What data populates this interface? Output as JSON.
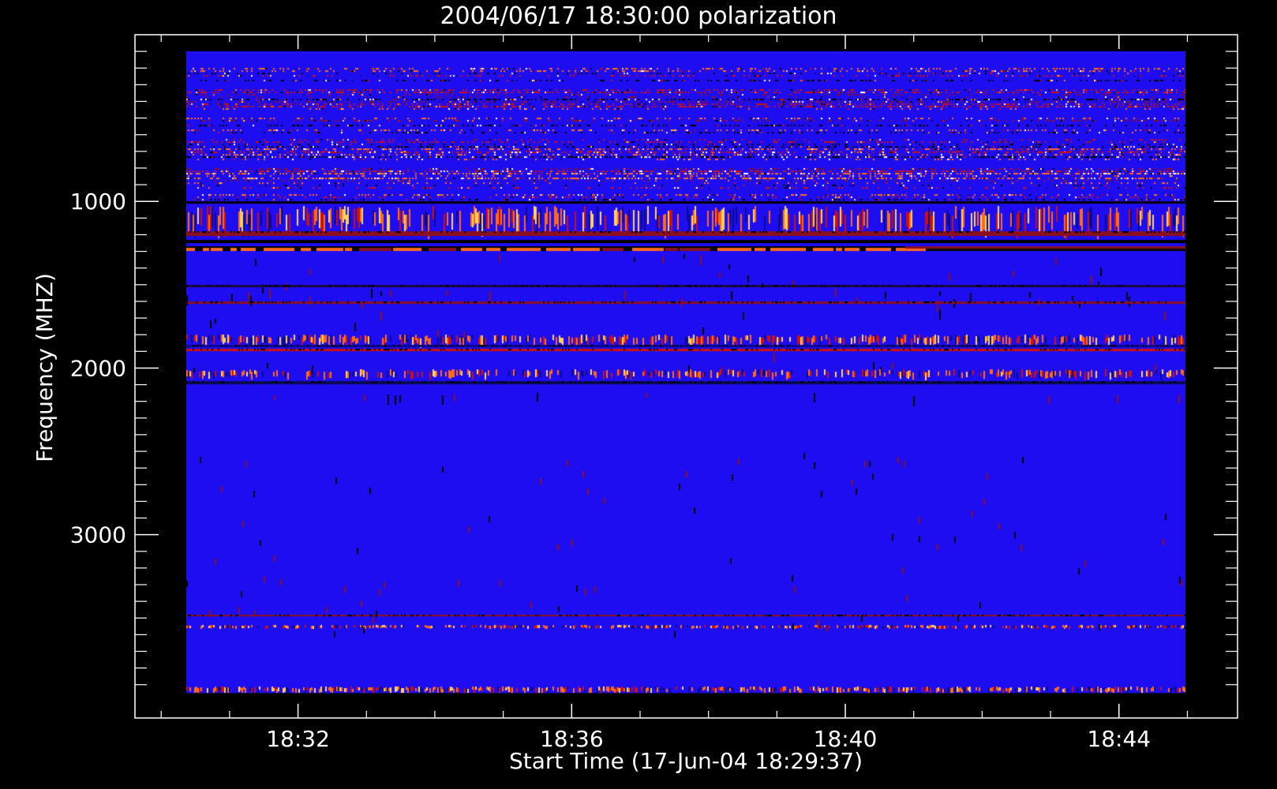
{
  "chart_data": {
    "type": "heatmap",
    "title": "2004/06/17 18:30:00 polarization",
    "xlabel": "Start Time (17-Jun-04 18:29:37)",
    "ylabel": "Frequency (MHZ)",
    "x_ticks": [
      {
        "label": "18:32",
        "minutes_after_1830": 2
      },
      {
        "label": "18:36",
        "minutes_after_1830": 6
      },
      {
        "label": "18:40",
        "minutes_after_1830": 10
      },
      {
        "label": "18:44",
        "minutes_after_1830": 14
      }
    ],
    "y_ticks": [
      {
        "label": "1000",
        "value": 1000
      },
      {
        "label": "2000",
        "value": 2000
      },
      {
        "label": "3000",
        "value": 3000
      }
    ],
    "xlim": [
      "18:29:37",
      "18:45:44"
    ],
    "ylim": [
      4100,
      0
    ],
    "data_time_range": [
      "18:30:00",
      "18:45:00"
    ],
    "data_frequency_range_mhz": [
      100,
      3950
    ],
    "colors": {
      "background": "#000000",
      "axes": "#ffffff",
      "base": "#1f0df2",
      "dark_blue": "#0a0a8c",
      "black": "#000000",
      "red": "#cc1010",
      "dark_red": "#8a1020",
      "orange": "#ff6a1a",
      "yellow": "#ffd060",
      "white": "#ffffff"
    },
    "bands": [
      {
        "f0": 100,
        "f1": 200,
        "kind": "solid",
        "color": "#1f0df2"
      },
      {
        "f0": 200,
        "f1": 700,
        "kind": "dense"
      },
      {
        "f0": 700,
        "f1": 870,
        "kind": "denseBright"
      },
      {
        "f0": 870,
        "f1": 1000,
        "kind": "medium"
      },
      {
        "f0": 1000,
        "f1": 1030,
        "kind": "line",
        "color": "#000000"
      },
      {
        "f0": 1030,
        "f1": 1180,
        "kind": "vertical",
        "density": 0.45
      },
      {
        "f0": 1180,
        "f1": 1230,
        "kind": "line",
        "color": "#8a1020"
      },
      {
        "f0": 1230,
        "f1": 1270,
        "kind": "line",
        "color": "#000000"
      },
      {
        "f0": 1270,
        "f1": 1300,
        "kind": "orangeDash"
      },
      {
        "f0": 1300,
        "f1": 1500,
        "kind": "sparse",
        "density": 0.04
      },
      {
        "f0": 1500,
        "f1": 1525,
        "kind": "line",
        "color": "#1a0a40"
      },
      {
        "f0": 1525,
        "f1": 1600,
        "kind": "sparse",
        "density": 0.05
      },
      {
        "f0": 1600,
        "f1": 1625,
        "kind": "line",
        "color": "#8a1020"
      },
      {
        "f0": 1625,
        "f1": 1800,
        "kind": "sparse",
        "density": 0.03
      },
      {
        "f0": 1800,
        "f1": 1860,
        "kind": "vertical",
        "density": 0.55
      },
      {
        "f0": 1860,
        "f1": 1885,
        "kind": "line",
        "color": "#0a0a8c"
      },
      {
        "f0": 1885,
        "f1": 1910,
        "kind": "line",
        "color": "#cc1010"
      },
      {
        "f0": 1910,
        "f1": 2010,
        "kind": "sparse",
        "density": 0.02
      },
      {
        "f0": 2010,
        "f1": 2060,
        "kind": "vertical",
        "density": 0.4
      },
      {
        "f0": 2080,
        "f1": 2110,
        "kind": "line",
        "color": "#0a0a50"
      },
      {
        "f0": 2150,
        "f1": 2180,
        "kind": "sparse",
        "density": 0.04
      },
      {
        "f0": 3480,
        "f1": 3500,
        "kind": "line",
        "color": "#8a1020"
      },
      {
        "f0": 3540,
        "f1": 3565,
        "kind": "vertical",
        "density": 0.5
      },
      {
        "f0": 3910,
        "f1": 3950,
        "kind": "vertical",
        "density": 0.6
      }
    ]
  }
}
